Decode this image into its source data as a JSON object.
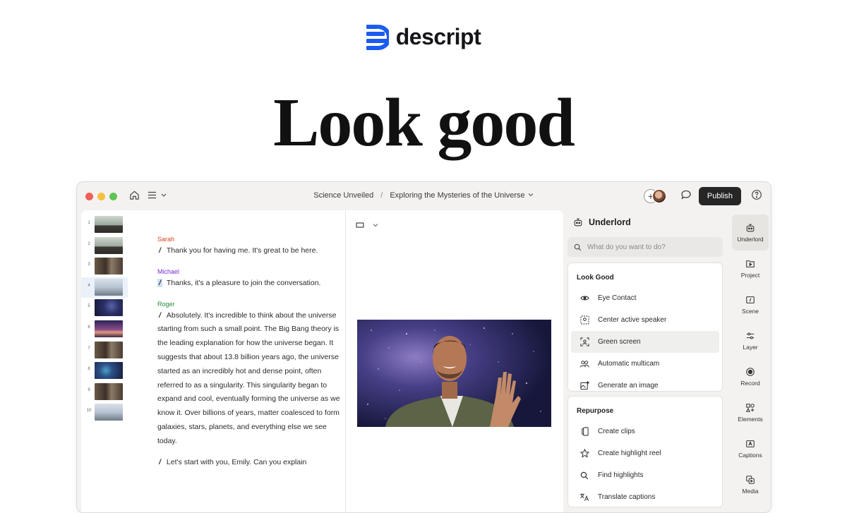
{
  "brand": {
    "name": "descript",
    "color": "#1a5cf0"
  },
  "headline": "Look good",
  "window": {
    "breadcrumb": {
      "project": "Science Unveiled",
      "separator": "/",
      "composition": "Exploring the Mysteries of the Universe"
    },
    "publish_label": "Publish"
  },
  "thumbnails": [
    {
      "num": "1",
      "style": "office"
    },
    {
      "num": "2",
      "style": "office"
    },
    {
      "num": "3",
      "style": "office2"
    },
    {
      "num": "4",
      "style": "light",
      "active": true
    },
    {
      "num": "5",
      "style": "space"
    },
    {
      "num": "6",
      "style": "dusk"
    },
    {
      "num": "7",
      "style": "office2"
    },
    {
      "num": "8",
      "style": "nebula"
    },
    {
      "num": "9",
      "style": "office2"
    },
    {
      "num": "10",
      "style": "light"
    }
  ],
  "transcript": {
    "sarah": {
      "speaker": "Sarah",
      "text": "Thank you for having me. It's great to be here."
    },
    "michael": {
      "speaker": "Michael",
      "text": "Thanks, it's a pleasure to join the conversation."
    },
    "roger": {
      "speaker": "Roger",
      "text": "Absolutely. It's incredible to think about the universe starting from such a small point. The Big Bang theory is the leading explanation for how the universe began. It suggests that about 13.8 billion years ago, the universe started as an incredibly hot and dense point, often referred to as a singularity. This singularity began to expand and cool, eventually forming the universe as we know it. Over billions of years, matter coalesced to form galaxies, stars, planets, and everything else we see today."
    },
    "next": "Let's start with you, Emily. Can you explain"
  },
  "underlord": {
    "title": "Underlord",
    "search_placeholder": "What do you want to do?",
    "look_good": {
      "title": "Look Good",
      "items": [
        "Eye Contact",
        "Center active speaker",
        "Green screen",
        "Automatic multicam",
        "Generate an image"
      ]
    },
    "repurpose": {
      "title": "Repurpose",
      "items": [
        "Create clips",
        "Create highlight reel",
        "Find highlights",
        "Translate captions"
      ]
    }
  },
  "rail": [
    "Underlord",
    "Project",
    "Scene",
    "Layer",
    "Record",
    "Elements",
    "Captions",
    "Media"
  ]
}
